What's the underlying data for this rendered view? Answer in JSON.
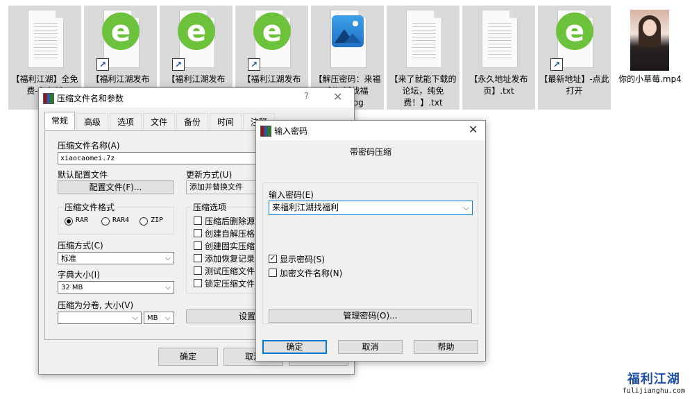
{
  "desktop_files": [
    {
      "name": "【福利江湖】全免费-永久新",
      "type": "txt"
    },
    {
      "name": "【福利江湖发布",
      "type": "ie-shortcut"
    },
    {
      "name": "【福利江湖发布",
      "type": "ie-shortcut"
    },
    {
      "name": "【福利江湖发布",
      "type": "ie-shortcut"
    },
    {
      "name": "【解压密码：来福利江湖找福利】.jpg",
      "type": "image"
    },
    {
      "name": "【来了就能下载的论坛，纯免费！】.txt",
      "type": "txt"
    },
    {
      "name": "【永久地址发布页】.txt",
      "type": "txt"
    },
    {
      "name": "【最新地址】-点此打开",
      "type": "ie-shortcut"
    },
    {
      "name": "你的小草莓.mp4",
      "type": "video"
    }
  ],
  "archive_dialog": {
    "title": "压缩文件名和参数",
    "help": "?",
    "close": "✕",
    "tabs": [
      "常规",
      "高级",
      "选项",
      "文件",
      "备份",
      "时间",
      "注释"
    ],
    "archive_name_label": "压缩文件名称(A)",
    "archive_name_value": "xiaocaomei.7z",
    "default_profile_label": "默认配置文件",
    "profile_button": "配置文件(F)...",
    "update_mode_label": "更新方式(U)",
    "update_mode_value": "添加并替换文件",
    "format_group": "压缩文件格式",
    "formats": [
      "RAR",
      "RAR4",
      "ZIP"
    ],
    "method_label": "压缩方式(C)",
    "method_value": "标准",
    "dict_label": "字典大小(I)",
    "dict_value": "32 MB",
    "split_label": "压缩为分卷, 大小(V)",
    "split_value": "",
    "split_unit": "MB",
    "options_group": "压缩选项",
    "options": [
      "压缩后删除源文件",
      "创建自解压格式",
      "创建固实压缩文件",
      "添加恢复记录",
      "测试压缩文件",
      "锁定压缩文件"
    ],
    "set_password_button": "设置密码",
    "ok": "确定",
    "cancel": "取消"
  },
  "password_dialog": {
    "title": "输入密码",
    "close": "✕",
    "heading": "带密码压缩",
    "password_label": "输入密码(E)",
    "password_value": "来福利江湖找福利",
    "show_password": "显示密码(S)",
    "show_password_checked": true,
    "encrypt_names": "加密文件名称(N)",
    "encrypt_names_checked": false,
    "manage_button": "管理密码(O)...",
    "ok": "确定",
    "cancel": "取消",
    "help": "帮助"
  },
  "watermark": {
    "brand": "福利江湖",
    "url": "fulijianghu.com"
  }
}
